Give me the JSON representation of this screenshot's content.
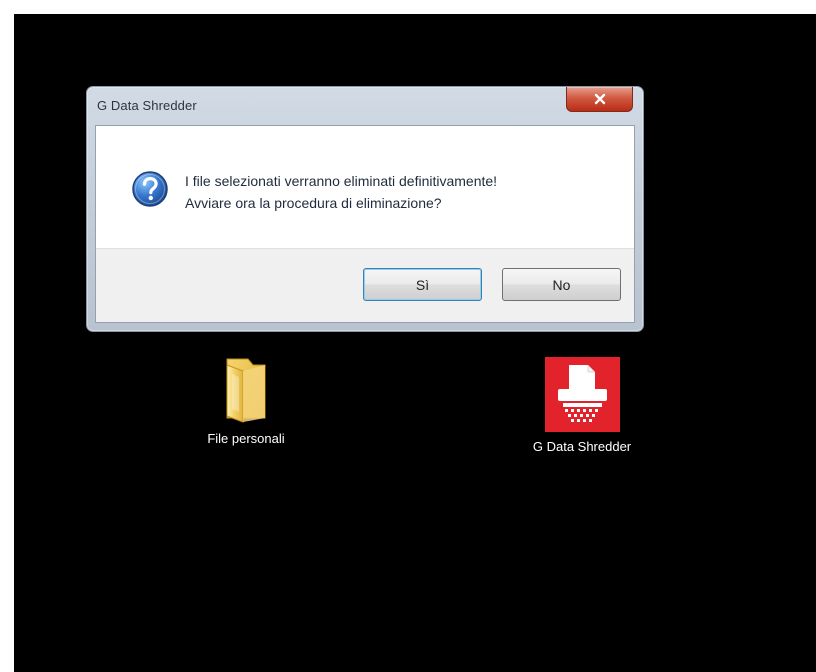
{
  "dialog": {
    "title": "G Data Shredder",
    "message_line_1": "I file selezionati verranno eliminati definitivamente!",
    "message_line_2": "Avviare ora la procedura di eliminazione?",
    "buttons": {
      "yes_label": "Sì",
      "no_label": "No"
    }
  },
  "desktop_icons": [
    {
      "label": "File personali",
      "icon": "folder-icon"
    },
    {
      "label": "G Data Shredder",
      "icon": "shredder-icon"
    }
  ],
  "colors": {
    "desktop_background": "#000000",
    "dialog_frame": "#c7d1dc",
    "close_button": "#c63f25",
    "message_text": "#1f2b3d",
    "question_icon": "#2f6fc0",
    "shredder_icon_background": "#e3232c"
  }
}
